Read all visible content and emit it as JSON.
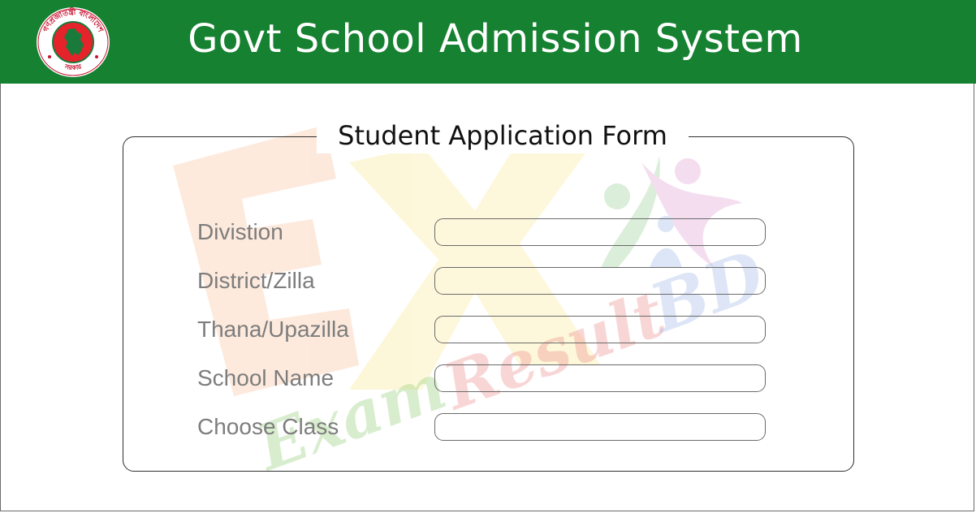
{
  "header": {
    "title": "Govt School Admission System",
    "background_color": "#168130",
    "seal": {
      "icon": "bangladesh-government-seal-icon",
      "ring_text_top": "গণপ্রজাতন্ত্রী বাংলাদেশ",
      "ring_text_bottom": "সরকার"
    }
  },
  "form": {
    "legend": "Student Application Form",
    "fields": [
      {
        "label": "Divistion",
        "value": ""
      },
      {
        "label": "District/Zilla",
        "value": ""
      },
      {
        "label": "Thana/Upazilla",
        "value": ""
      },
      {
        "label": "School Name",
        "value": ""
      },
      {
        "label": "Choose Class",
        "value": ""
      }
    ]
  },
  "watermark": {
    "letters": "EX",
    "text_line1": "Exam",
    "text_line2": "Result",
    "text_line3": "BD"
  }
}
